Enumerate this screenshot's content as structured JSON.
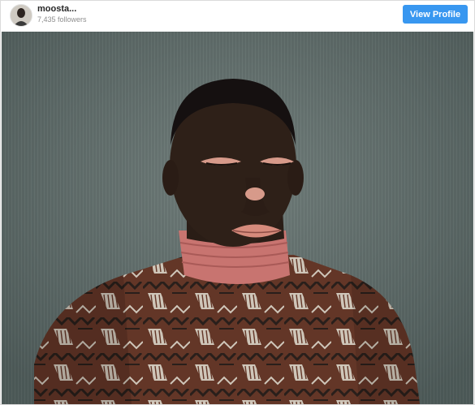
{
  "header": {
    "username": "moosta...",
    "followers": "7,435 followers",
    "view_profile_label": "View Profile"
  },
  "avatar": {
    "icon": "profile-avatar"
  },
  "post": {
    "image_subject": "portrait-photo",
    "colors": {
      "background": "#5d6a68",
      "skin": "#2e2018",
      "vitiligo": "#d79a8a",
      "collar": "#c87470",
      "sweater_brown": "#6b3a2a",
      "sweater_cream": "#e6ddd0",
      "sweater_dark": "#2a1f1c"
    }
  },
  "accent": "#3897f0"
}
